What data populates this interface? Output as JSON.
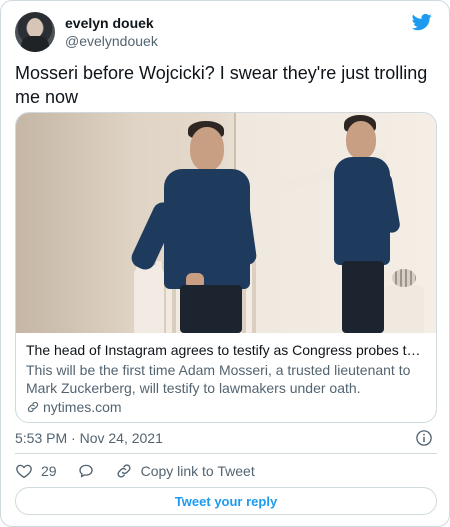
{
  "user": {
    "display_name": "evelyn douek",
    "handle": "@evelyndouek"
  },
  "tweet": {
    "text": "Mosseri before Wojcicki? I swear they're just trolling me now",
    "timestamp": "5:53 PM · Nov 24, 2021"
  },
  "card": {
    "title": "The head of Instagram agrees to testify as Congress probes the app’s ...",
    "description": "This will be the first time Adam Mosseri, a trusted lieutenant to Mark Zuckerberg, will testify to lawmakers under oath.",
    "domain": "nytimes.com"
  },
  "actions": {
    "like_count": "29",
    "copy_link_label": "Copy link to Tweet"
  },
  "reply_button_label": "Tweet your reply",
  "colors": {
    "brand": "#1d9bf0",
    "text_primary": "#0f1419",
    "text_secondary": "#536471",
    "border": "#cfd9de"
  },
  "icons": [
    "twitter-bird-icon",
    "info-icon",
    "heart-icon",
    "reply-icon",
    "link-icon"
  ]
}
